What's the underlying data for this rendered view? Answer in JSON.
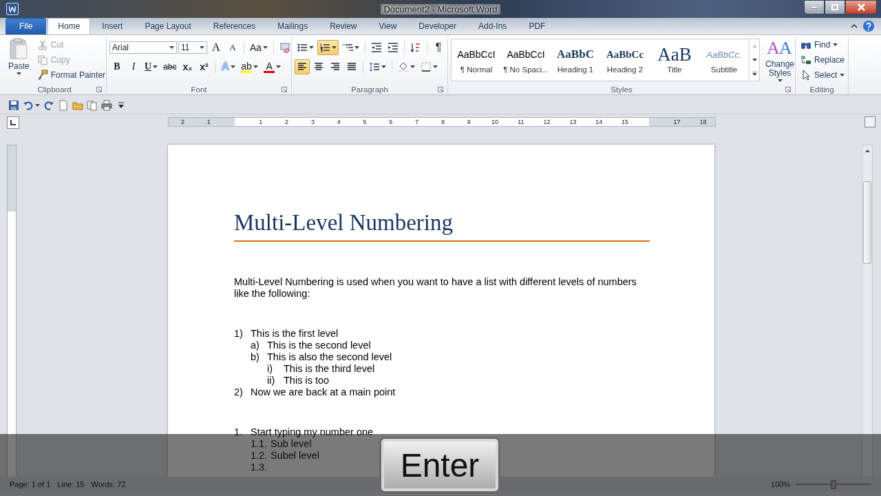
{
  "window": {
    "title": "Document2 - Microsoft Word"
  },
  "tabs": [
    {
      "label": "File",
      "kind": "file",
      "selected": false
    },
    {
      "label": "Home",
      "kind": "tab",
      "selected": true
    },
    {
      "label": "Insert",
      "kind": "tab",
      "selected": false
    },
    {
      "label": "Page Layout",
      "kind": "tab",
      "selected": false
    },
    {
      "label": "References",
      "kind": "tab",
      "selected": false
    },
    {
      "label": "Mailings",
      "kind": "tab",
      "selected": false
    },
    {
      "label": "Review",
      "kind": "tab",
      "selected": false
    },
    {
      "label": "View",
      "kind": "tab",
      "selected": false
    },
    {
      "label": "Developer",
      "kind": "tab",
      "selected": false
    },
    {
      "label": "Add-Ins",
      "kind": "tab",
      "selected": false
    },
    {
      "label": "PDF",
      "kind": "tab",
      "selected": false
    }
  ],
  "clipboard": {
    "label": "Clipboard",
    "paste": "Paste",
    "actions": [
      {
        "kind": "cut",
        "label": "Cut",
        "disabled": true
      },
      {
        "kind": "copy",
        "label": "Copy",
        "disabled": true
      },
      {
        "kind": "painter",
        "label": "Format Painter",
        "disabled": false
      }
    ]
  },
  "font": {
    "label": "Font",
    "font_name": "Arial",
    "font_size": "11",
    "row1": [
      {
        "kind": "grow",
        "glyph": "A"
      },
      {
        "kind": "shrink",
        "glyph": "A"
      },
      {
        "kind": "case",
        "glyph": "Aa"
      },
      {
        "kind": "clear"
      }
    ],
    "row2": [
      {
        "kind": "bold",
        "glyph": "B"
      },
      {
        "kind": "italic",
        "glyph": "I"
      },
      {
        "kind": "underline",
        "glyph": "U"
      },
      {
        "kind": "strike",
        "glyph": "abc"
      },
      {
        "kind": "sub",
        "glyph": "x₂"
      },
      {
        "kind": "sup",
        "glyph": "x²"
      },
      {
        "kind": "effects",
        "glyph": "A"
      },
      {
        "kind": "highlight",
        "glyph": "ab",
        "color": "#ffff00"
      },
      {
        "kind": "fontcolor",
        "glyph": "A",
        "color": "#e00000"
      }
    ]
  },
  "paragraph": {
    "label": "Paragraph",
    "row1": [
      {
        "kind": "bullets",
        "selected": false
      },
      {
        "kind": "numbering",
        "selected": true
      },
      {
        "kind": "multilevel",
        "selected": false
      },
      {
        "kind": "outdent",
        "selected": false
      },
      {
        "kind": "indent",
        "selected": false
      },
      {
        "kind": "sort",
        "selected": false
      },
      {
        "kind": "marks",
        "glyph": "¶",
        "selected": false
      }
    ],
    "row2": [
      {
        "kind": "left",
        "selected": true
      },
      {
        "kind": "center",
        "selected": false
      },
      {
        "kind": "right",
        "selected": false
      },
      {
        "kind": "justify",
        "selected": false
      },
      {
        "kind": "spacing",
        "selected": false
      },
      {
        "kind": "shading",
        "selected": false
      },
      {
        "kind": "borders",
        "selected": false
      }
    ]
  },
  "styles": {
    "label": "Styles",
    "items": [
      {
        "kind": "normal",
        "preview": "AaBbCcI",
        "name": "¶ Normal",
        "selected": false
      },
      {
        "kind": "normal",
        "preview": "AaBbCcI",
        "name": "¶ No Spaci...",
        "selected": false
      },
      {
        "kind": "heading1",
        "preview": "AaBbC",
        "name": "Heading 1",
        "selected": false
      },
      {
        "kind": "heading2",
        "preview": "AaBbCc",
        "name": "Heading 2",
        "selected": false
      },
      {
        "kind": "title",
        "preview": "AaB",
        "name": "Title",
        "selected": false
      },
      {
        "kind": "subtitle",
        "preview": "AaBbCc.",
        "name": "Subtitle",
        "selected": false
      }
    ],
    "change_styles": {
      "glyphs": [
        "A",
        "A"
      ],
      "label": "Change Styles"
    }
  },
  "editing": {
    "label": "Editing",
    "actions": [
      {
        "kind": "find",
        "label": "Find"
      },
      {
        "kind": "replace",
        "label": "Replace"
      },
      {
        "kind": "select",
        "label": "Select"
      }
    ]
  },
  "quick_access": [
    {
      "kind": "save"
    },
    {
      "kind": "undo"
    },
    {
      "kind": "redo"
    },
    {
      "kind": "new"
    },
    {
      "kind": "open"
    },
    {
      "kind": "preview"
    },
    {
      "kind": "print"
    },
    {
      "kind": "customize"
    }
  ],
  "ruler": {
    "labels": [
      "2",
      "1",
      "1",
      "2",
      "3",
      "4",
      "5",
      "6",
      "7",
      "8",
      "9",
      "10",
      "11",
      "12",
      "13",
      "14",
      "15",
      "17",
      "18"
    ]
  },
  "document": {
    "heading": "Multi-Level Numbering",
    "paragraph": "Multi-Level Numbering is used when you want to have a list with different levels of numbers like the following:",
    "lists": [
      [
        {
          "marker": "1)",
          "text": "This is the first level",
          "children": [
            {
              "marker": "a)",
              "text": "This is the second level"
            },
            {
              "marker": "b)",
              "text": "This is also the second level",
              "children": [
                {
                  "marker": "i)",
                  "text": "This is the third level"
                },
                {
                  "marker": "ii)",
                  "text": "This is too"
                }
              ]
            }
          ]
        },
        {
          "marker": "2)",
          "text": "Now we are back at a main point"
        }
      ],
      [
        {
          "marker": "1.",
          "text": "Start typing my number one",
          "children": [
            {
              "marker": "1.1.",
              "text": "Sub level"
            },
            {
              "marker": "1.2.",
              "text": "Subel level"
            },
            {
              "marker": "1.3."
            }
          ]
        }
      ]
    ]
  },
  "status_bar": {
    "page": "Page: 1 of 1",
    "line": "Line: 15",
    "words": "Words: 72",
    "zoom": "100%",
    "zoom_level": {
      "level": 0.5
    }
  },
  "key_overlay": {
    "key": "Enter"
  }
}
